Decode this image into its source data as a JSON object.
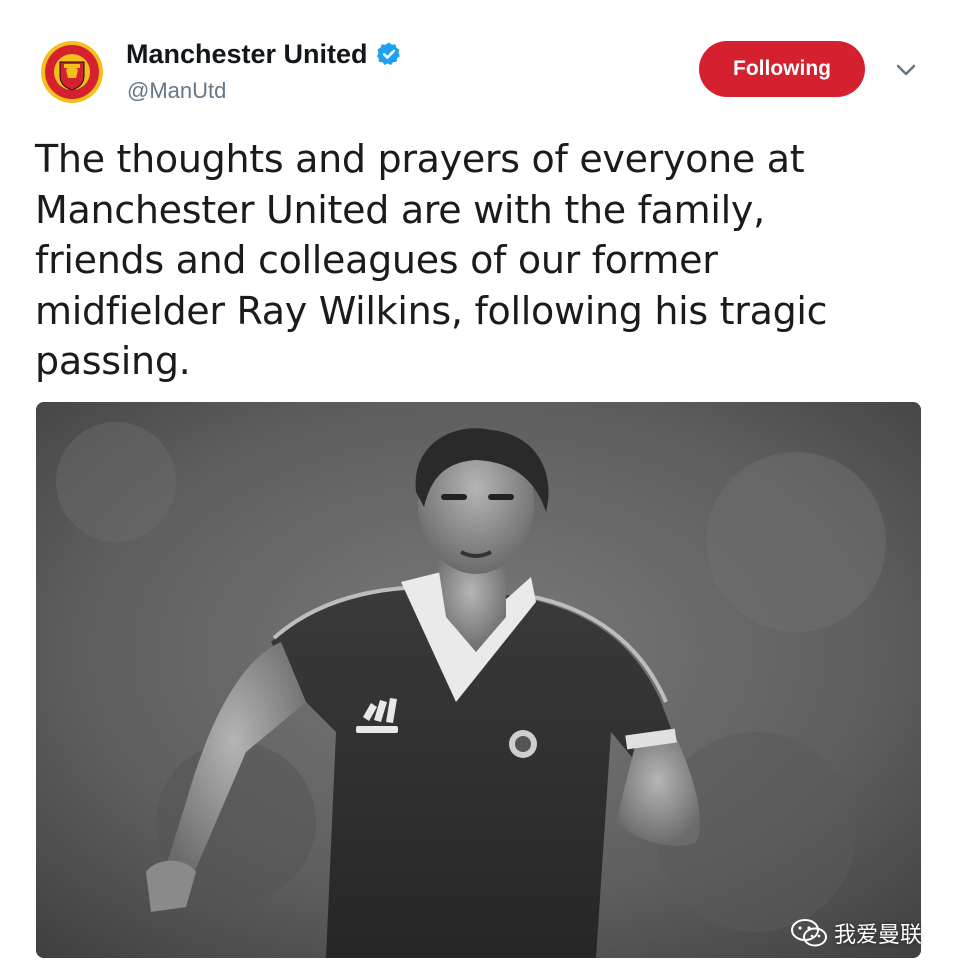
{
  "account": {
    "display_name": "Manchester United",
    "handle": "@ManUtd",
    "avatar_icon": "manchester-united-crest",
    "verified_icon": "verified-badge-icon"
  },
  "actions": {
    "follow_label": "Following",
    "menu_icon": "chevron-down-icon"
  },
  "tweet": {
    "lines": [
      "The thoughts and prayers of everyone at",
      "Manchester United are with the family,",
      "friends and colleagues of our former",
      "midfielder Ray Wilkins, following his tragic",
      "passing."
    ]
  },
  "media": {
    "description_icon": "black-and-white-football-player-photo"
  },
  "watermark": {
    "icon": "wechat-icon",
    "text": "我爱曼联"
  },
  "colors": {
    "follow_button": "#d4202f",
    "verified": "#1da1f2",
    "handle": "#657786"
  }
}
